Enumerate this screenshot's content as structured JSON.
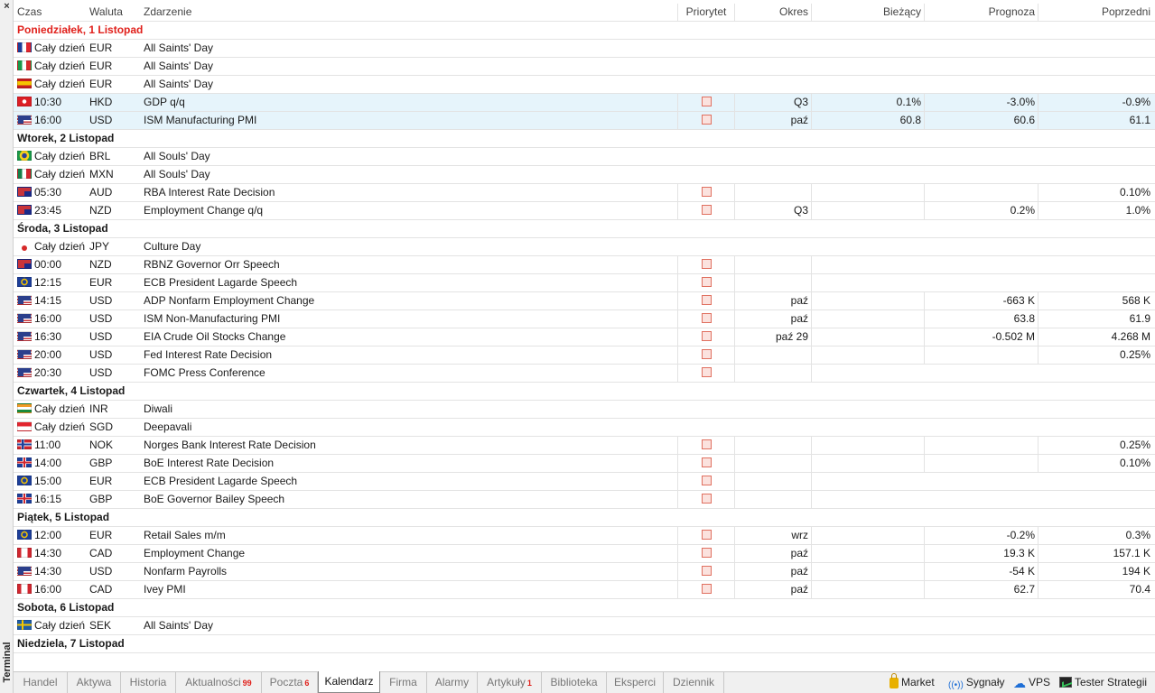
{
  "panel": {
    "title": "Terminal",
    "close_glyph": "×"
  },
  "columns": {
    "time": "Czas",
    "currency": "Waluta",
    "event": "Zdarzenie",
    "priority": "Priorytet",
    "period": "Okres",
    "actual": "Bieżący",
    "forecast": "Prognoza",
    "previous": "Poprzedni"
  },
  "colors": {
    "today_label": "#e0201b",
    "selected_row": "#e6f4fb",
    "badge": "#e0201b"
  },
  "rows": [
    {
      "type": "day",
      "label": "Poniedziałek, 1 Listopad",
      "today": true
    },
    {
      "type": "event",
      "flag": "fr",
      "time": "Cały dzień",
      "cur": "EUR",
      "ev": "All Saints' Day",
      "prio": false,
      "period": "",
      "actual": "",
      "forecast": "",
      "prev": ""
    },
    {
      "type": "event",
      "flag": "it",
      "time": "Cały dzień",
      "cur": "EUR",
      "ev": "All Saints' Day",
      "prio": false,
      "period": "",
      "actual": "",
      "forecast": "",
      "prev": ""
    },
    {
      "type": "event",
      "flag": "es",
      "time": "Cały dzień",
      "cur": "EUR",
      "ev": "All Saints' Day",
      "prio": false,
      "period": "",
      "actual": "",
      "forecast": "",
      "prev": ""
    },
    {
      "type": "event",
      "flag": "hk",
      "time": "10:30",
      "cur": "HKD",
      "ev": "GDP q/q",
      "prio": true,
      "period": "Q3",
      "actual": "0.1%",
      "forecast": "-3.0%",
      "prev": "-0.9%",
      "sel": true,
      "grid": "full"
    },
    {
      "type": "event",
      "flag": "us",
      "time": "16:00",
      "cur": "USD",
      "ev": "ISM Manufacturing PMI",
      "prio": true,
      "period": "paź",
      "actual": "60.8",
      "forecast": "60.6",
      "prev": "61.1",
      "sel": true,
      "grid": "full"
    },
    {
      "type": "day",
      "label": "Wtorek, 2 Listopad"
    },
    {
      "type": "event",
      "flag": "br",
      "time": "Cały dzień",
      "cur": "BRL",
      "ev": "All Souls' Day",
      "prio": false,
      "period": "",
      "actual": "",
      "forecast": "",
      "prev": ""
    },
    {
      "type": "event",
      "flag": "mx",
      "time": "Cały dzień",
      "cur": "MXN",
      "ev": "All Souls' Day",
      "prio": false,
      "period": "",
      "actual": "",
      "forecast": "",
      "prev": ""
    },
    {
      "type": "event",
      "flag": "au",
      "time": "05:30",
      "cur": "AUD",
      "ev": "RBA Interest Rate Decision",
      "prio": true,
      "period": "",
      "actual": "",
      "forecast": "",
      "prev": "0.10%",
      "grid": "full"
    },
    {
      "type": "event",
      "flag": "nz",
      "time": "23:45",
      "cur": "NZD",
      "ev": "Employment Change q/q",
      "prio": true,
      "period": "Q3",
      "actual": "",
      "forecast": "0.2%",
      "prev": "1.0%",
      "grid": "full"
    },
    {
      "type": "day",
      "label": "Środa, 3 Listopad"
    },
    {
      "type": "event",
      "flag": "jp",
      "time": "Cały dzień",
      "cur": "JPY",
      "ev": "Culture Day",
      "prio": false,
      "period": "",
      "actual": "",
      "forecast": "",
      "prev": ""
    },
    {
      "type": "event",
      "flag": "nz",
      "time": "00:00",
      "cur": "NZD",
      "ev": "RBNZ Governor Orr Speech",
      "prio": true,
      "period": "",
      "actual": "",
      "forecast": "",
      "prev": "",
      "grid": "pr"
    },
    {
      "type": "event",
      "flag": "eu",
      "time": "12:15",
      "cur": "EUR",
      "ev": "ECB President Lagarde Speech",
      "prio": true,
      "period": "",
      "actual": "",
      "forecast": "",
      "prev": "",
      "grid": "pr"
    },
    {
      "type": "event",
      "flag": "us",
      "time": "14:15",
      "cur": "USD",
      "ev": "ADP Nonfarm Employment Change",
      "prio": true,
      "period": "paź",
      "actual": "",
      "forecast": "-663 K",
      "prev": "568 K",
      "grid": "full"
    },
    {
      "type": "event",
      "flag": "us",
      "time": "16:00",
      "cur": "USD",
      "ev": "ISM Non-Manufacturing PMI",
      "prio": true,
      "period": "paź",
      "actual": "",
      "forecast": "63.8",
      "prev": "61.9",
      "grid": "full"
    },
    {
      "type": "event",
      "flag": "us",
      "time": "16:30",
      "cur": "USD",
      "ev": "EIA Crude Oil Stocks Change",
      "prio": true,
      "period": "paź 29",
      "actual": "",
      "forecast": "-0.502 M",
      "prev": "4.268 M",
      "grid": "full"
    },
    {
      "type": "event",
      "flag": "us",
      "time": "20:00",
      "cur": "USD",
      "ev": "Fed Interest Rate Decision",
      "prio": true,
      "period": "",
      "actual": "",
      "forecast": "",
      "prev": "0.25%",
      "grid": "full"
    },
    {
      "type": "event",
      "flag": "us",
      "time": "20:30",
      "cur": "USD",
      "ev": "FOMC Press Conference",
      "prio": true,
      "period": "",
      "actual": "",
      "forecast": "",
      "prev": "",
      "grid": "pr"
    },
    {
      "type": "day",
      "label": "Czwartek, 4 Listopad"
    },
    {
      "type": "event",
      "flag": "in",
      "time": "Cały dzień",
      "cur": "INR",
      "ev": "Diwali",
      "prio": false,
      "period": "",
      "actual": "",
      "forecast": "",
      "prev": ""
    },
    {
      "type": "event",
      "flag": "sg",
      "time": "Cały dzień",
      "cur": "SGD",
      "ev": "Deepavali",
      "prio": false,
      "period": "",
      "actual": "",
      "forecast": "",
      "prev": ""
    },
    {
      "type": "event",
      "flag": "no",
      "time": "11:00",
      "cur": "NOK",
      "ev": "Norges Bank Interest Rate Decision",
      "prio": true,
      "period": "",
      "actual": "",
      "forecast": "",
      "prev": "0.25%",
      "grid": "full"
    },
    {
      "type": "event",
      "flag": "gb",
      "time": "14:00",
      "cur": "GBP",
      "ev": "BoE Interest Rate Decision",
      "prio": true,
      "period": "",
      "actual": "",
      "forecast": "",
      "prev": "0.10%",
      "grid": "full"
    },
    {
      "type": "event",
      "flag": "eu",
      "time": "15:00",
      "cur": "EUR",
      "ev": "ECB President Lagarde Speech",
      "prio": true,
      "period": "",
      "actual": "",
      "forecast": "",
      "prev": "",
      "grid": "pr"
    },
    {
      "type": "event",
      "flag": "gb",
      "time": "16:15",
      "cur": "GBP",
      "ev": "BoE Governor Bailey Speech",
      "prio": true,
      "period": "",
      "actual": "",
      "forecast": "",
      "prev": "",
      "grid": "pr"
    },
    {
      "type": "day",
      "label": "Piątek, 5 Listopad"
    },
    {
      "type": "event",
      "flag": "eu",
      "time": "12:00",
      "cur": "EUR",
      "ev": "Retail Sales m/m",
      "prio": true,
      "period": "wrz",
      "actual": "",
      "forecast": "-0.2%",
      "prev": "0.3%",
      "grid": "full"
    },
    {
      "type": "event",
      "flag": "ca",
      "time": "14:30",
      "cur": "CAD",
      "ev": "Employment Change",
      "prio": true,
      "period": "paź",
      "actual": "",
      "forecast": "19.3 K",
      "prev": "157.1 K",
      "grid": "full"
    },
    {
      "type": "event",
      "flag": "us",
      "time": "14:30",
      "cur": "USD",
      "ev": "Nonfarm Payrolls",
      "prio": true,
      "period": "paź",
      "actual": "",
      "forecast": "-54 K",
      "prev": "194 K",
      "grid": "full"
    },
    {
      "type": "event",
      "flag": "ca",
      "time": "16:00",
      "cur": "CAD",
      "ev": "Ivey PMI",
      "prio": true,
      "period": "paź",
      "actual": "",
      "forecast": "62.7",
      "prev": "70.4",
      "grid": "full"
    },
    {
      "type": "day",
      "label": "Sobota, 6 Listopad"
    },
    {
      "type": "event",
      "flag": "se",
      "time": "Cały dzień",
      "cur": "SEK",
      "ev": "All Saints' Day",
      "prio": false,
      "period": "",
      "actual": "",
      "forecast": "",
      "prev": ""
    },
    {
      "type": "day",
      "label": "Niedziela, 7 Listopad"
    }
  ],
  "tabs": [
    {
      "label": "Handel",
      "badge": ""
    },
    {
      "label": "Aktywa",
      "badge": ""
    },
    {
      "label": "Historia",
      "badge": ""
    },
    {
      "label": "Aktualności",
      "badge": "99"
    },
    {
      "label": "Poczta",
      "badge": "6"
    },
    {
      "label": "Kalendarz",
      "badge": "",
      "active": true
    },
    {
      "label": "Firma",
      "badge": ""
    },
    {
      "label": "Alarmy",
      "badge": ""
    },
    {
      "label": "Artykuły",
      "badge": "1"
    },
    {
      "label": "Biblioteka",
      "badge": ""
    },
    {
      "label": "Eksperci",
      "badge": ""
    },
    {
      "label": "Dziennik",
      "badge": ""
    }
  ],
  "status": {
    "market": {
      "label": "Market",
      "icon": "lock-icon"
    },
    "signals": {
      "label": "Sygnały",
      "icon": "signal-icon",
      "glyph": "((•))"
    },
    "vps": {
      "label": "VPS",
      "icon": "cloud-icon",
      "glyph": "☁"
    },
    "tester": {
      "label": "Tester Strategii",
      "icon": "tester-icon"
    }
  }
}
